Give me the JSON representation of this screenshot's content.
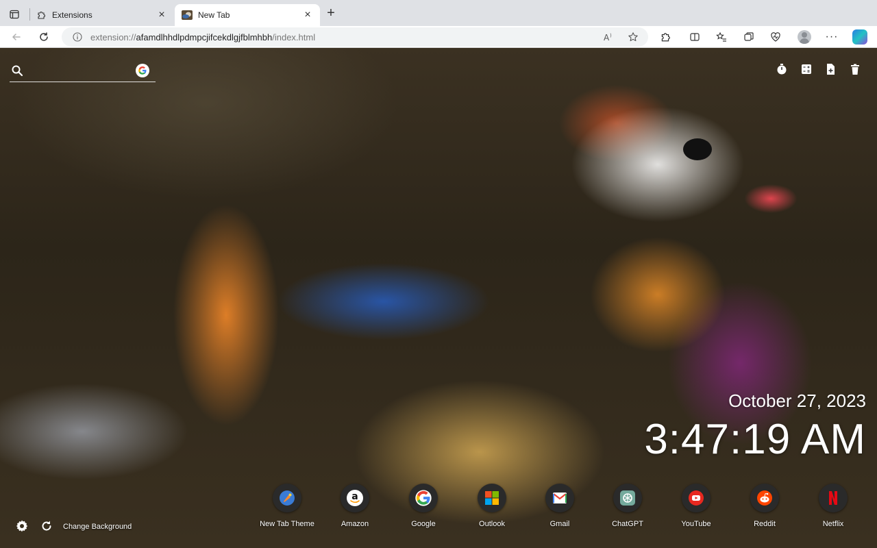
{
  "browser": {
    "tabs": [
      {
        "title": "Extensions",
        "icon": "puzzle-icon",
        "active": false
      },
      {
        "title": "New Tab",
        "icon": "duck-thumbnail-icon",
        "active": true
      }
    ],
    "address_bar": {
      "prefix": "extension://",
      "host": "afamdlhhdlpdmpcjifcekdlgjfblmhbh",
      "path": "/index.html"
    }
  },
  "page": {
    "search": {
      "placeholder": "",
      "engine": "Google"
    },
    "tools": [
      "timer-icon",
      "calculator-icon",
      "new-note-icon",
      "trash-icon"
    ],
    "clock": {
      "date": "October 27, 2023",
      "time": "3:47:19 AM"
    },
    "shortcuts": [
      {
        "label": "New Tab Theme",
        "icon": "new-tab-theme-icon"
      },
      {
        "label": "Amazon",
        "icon": "amazon-icon"
      },
      {
        "label": "Google",
        "icon": "google-icon"
      },
      {
        "label": "Outlook",
        "icon": "outlook-icon"
      },
      {
        "label": "Gmail",
        "icon": "gmail-icon"
      },
      {
        "label": "ChatGPT",
        "icon": "chatgpt-icon"
      },
      {
        "label": "YouTube",
        "icon": "youtube-icon"
      },
      {
        "label": "Reddit",
        "icon": "reddit-icon"
      },
      {
        "label": "Netflix",
        "icon": "netflix-icon"
      }
    ],
    "footer": {
      "change_background_label": "Change Background"
    }
  }
}
